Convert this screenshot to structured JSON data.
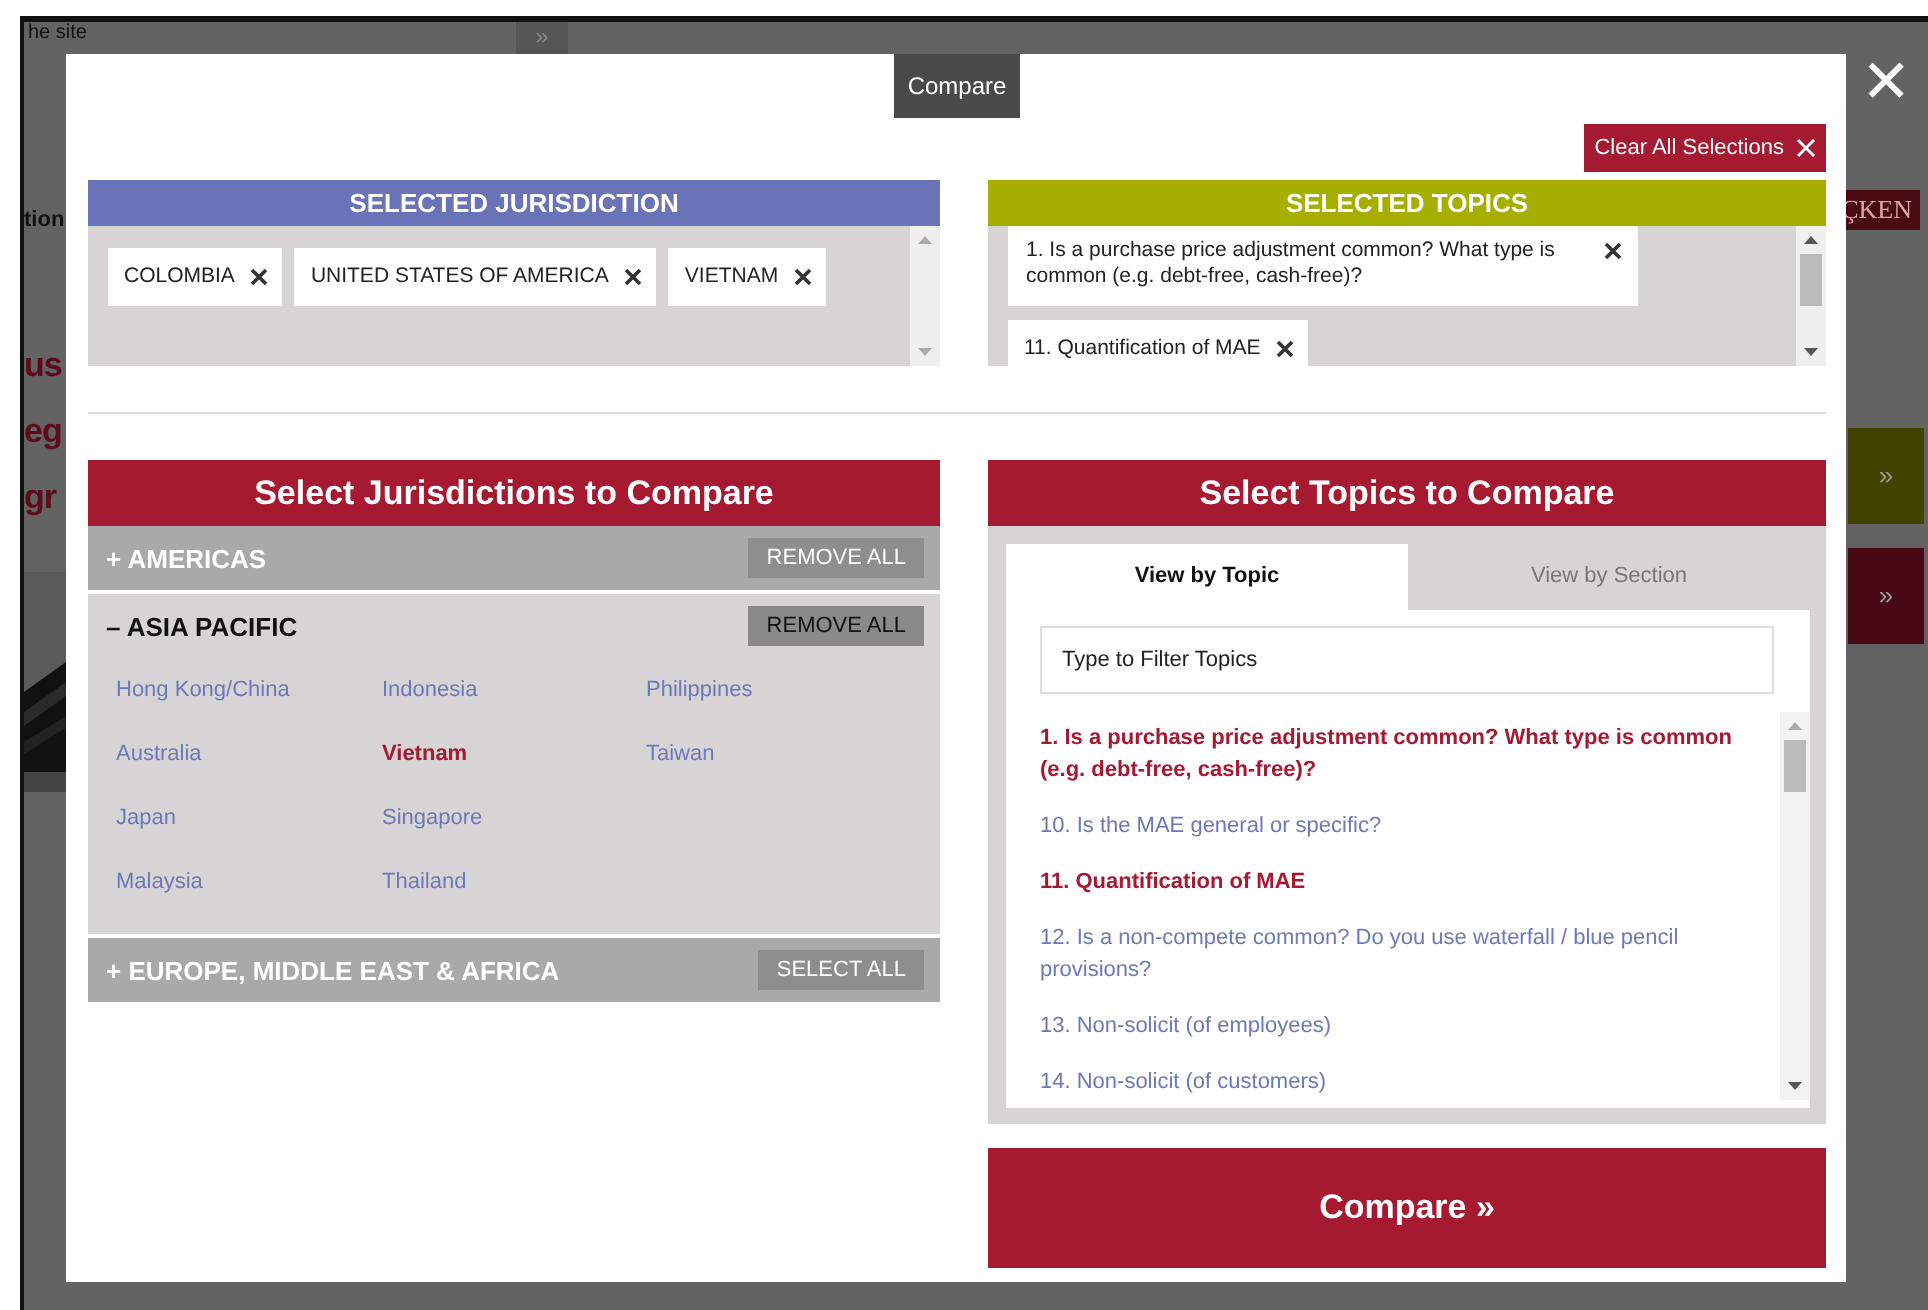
{
  "backdrop": {
    "items": [
      {
        "kind": "note",
        "text": "he site"
      },
      {
        "kind": "arrow",
        "text": "»"
      },
      {
        "kind": "label",
        "text": "tion"
      },
      {
        "kind": "heading",
        "text": "us"
      },
      {
        "kind": "heading",
        "text": "eg"
      },
      {
        "kind": "heading",
        "text": "gr"
      },
      {
        "kind": "logo",
        "text": "ÇKEN"
      },
      {
        "kind": "side-button",
        "text": "»",
        "color": "#434300"
      },
      {
        "kind": "side-button",
        "text": "»",
        "color": "#480816"
      }
    ]
  },
  "modal": {
    "tab": "Compare",
    "close": "✕",
    "clear_button": "Clear All Selections",
    "selected_jurisdiction": {
      "title": "SELECTED JURISDICTION",
      "chips": [
        "COLOMBIA",
        "UNITED STATES OF AMERICA",
        "VIETNAM"
      ]
    },
    "selected_topics": {
      "title": "SELECTED TOPICS",
      "chips": [
        "1. Is a purchase price adjustment common? What type is common (e.g. debt-free, cash-free)?",
        "11. Quantification of MAE"
      ]
    },
    "jurisdictions": {
      "title": "Select Jurisdictions to Compare",
      "groups": [
        {
          "toggle": "+",
          "name": "AMERICAS",
          "expanded": false,
          "action": "REMOVE ALL"
        },
        {
          "toggle": "–",
          "name": "ASIA PACIFIC",
          "expanded": true,
          "action": "REMOVE ALL",
          "items": [
            {
              "label": "Hong Kong/China",
              "selected": false
            },
            {
              "label": "Australia",
              "selected": false
            },
            {
              "label": "Japan",
              "selected": false
            },
            {
              "label": "Malaysia",
              "selected": false
            },
            {
              "label": "Indonesia",
              "selected": false
            },
            {
              "label": "Vietnam",
              "selected": true
            },
            {
              "label": "Singapore",
              "selected": false
            },
            {
              "label": "Thailand",
              "selected": false
            },
            {
              "label": "Philippines",
              "selected": false
            },
            {
              "label": "Taiwan",
              "selected": false
            }
          ]
        },
        {
          "toggle": "+",
          "name": "EUROPE, MIDDLE EAST & AFRICA",
          "expanded": false,
          "action": "SELECT ALL"
        }
      ]
    },
    "topics": {
      "title": "Select Topics to Compare",
      "tabs": [
        {
          "label": "View by Topic",
          "selected": true
        },
        {
          "label": "View by Section",
          "selected": false
        }
      ],
      "filter": {
        "placeholder": "Type to Filter Topics"
      },
      "items": [
        {
          "label": "1. Is a purchase price adjustment common? What type is common (e.g. debt-free, cash-free)?",
          "selected": true
        },
        {
          "label": "10. Is the MAE general or specific?",
          "selected": false
        },
        {
          "label": "11. Quantification of MAE",
          "selected": true
        },
        {
          "label": "12. Is a non-compete common? Do you use waterfall / blue pencil provisions?",
          "selected": false
        },
        {
          "label": "13. Non-solicit (of employees)",
          "selected": false
        },
        {
          "label": "14. Non-solicit (of customers)",
          "selected": false
        }
      ]
    },
    "compare_button": "Compare »"
  }
}
